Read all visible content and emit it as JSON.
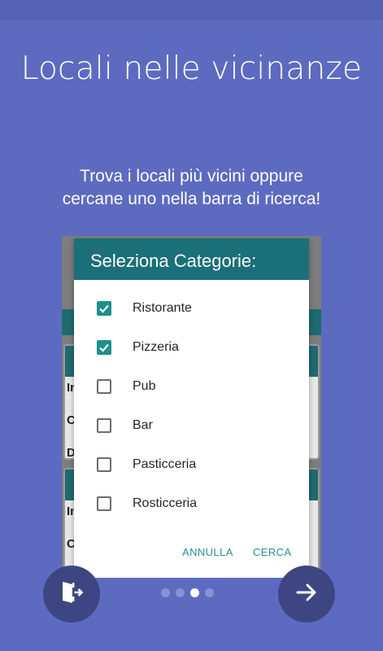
{
  "title": "Locali nelle vicinanze",
  "subtitle_line1": "Trova i locali più vicini oppure",
  "subtitle_line2": "cercane uno nella barra di ricerca!",
  "background_partial_letters": [
    "In",
    "C",
    "D",
    "In",
    "C"
  ],
  "dialog": {
    "title": "Seleziona Categorie:",
    "options": [
      {
        "label": "Ristorante",
        "checked": true
      },
      {
        "label": "Pizzeria",
        "checked": true
      },
      {
        "label": "Pub",
        "checked": false
      },
      {
        "label": "Bar",
        "checked": false
      },
      {
        "label": "Pasticceria",
        "checked": false
      },
      {
        "label": "Rosticceria",
        "checked": false
      }
    ],
    "cancel_label": "ANNULLA",
    "confirm_label": "CERCA"
  },
  "pager": {
    "total": 4,
    "active_index": 2
  },
  "icons": {
    "left": "exit-door-icon",
    "right": "arrow-right-icon"
  },
  "colors": {
    "background": "#5C6BC0",
    "dialog_header": "#1b6f78",
    "checkbox_checked": "#1f8f8a",
    "fab": "#3d4682"
  }
}
